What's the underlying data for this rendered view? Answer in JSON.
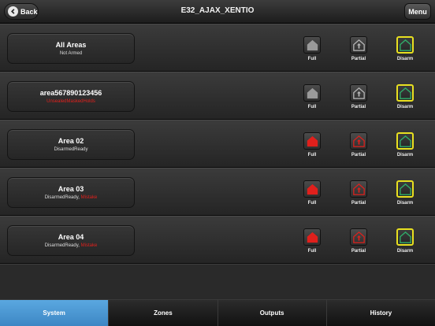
{
  "header": {
    "back_label": "Back",
    "title": "E32_AJAX_XENTIO",
    "menu_label": "Menu"
  },
  "actions": {
    "full": "Full",
    "partial": "Partial",
    "disarm": "Disarm"
  },
  "areas": [
    {
      "name": "All Areas",
      "status": "Not Armed",
      "status_red": "",
      "armed_full": false
    },
    {
      "name": "area567890123456",
      "status": "",
      "status_red": "UnsealedMaskedHolds",
      "armed_full": false
    },
    {
      "name": "Area 02",
      "status": "DisarmedReady",
      "status_red": "",
      "armed_full": true
    },
    {
      "name": "Area 03",
      "status": "DisarmedReady, ",
      "status_red": "Mistake",
      "armed_full": true
    },
    {
      "name": "Area 04",
      "status": "DisarmedReady, ",
      "status_red": "Mistake",
      "armed_full": true
    }
  ],
  "tabs": [
    "System",
    "Zones",
    "Outputs",
    "History"
  ],
  "active_tab": "System",
  "colors": {
    "accent_tab": "#4a9ad8",
    "alarm_red": "#e0201c",
    "disarm_border": "#e8e020",
    "disarm_icon": "#2fae6a"
  },
  "icons": {
    "back": "back-arrow-icon",
    "full": "house-full-icon",
    "partial": "house-partial-icon",
    "disarm": "house-disarm-icon"
  }
}
